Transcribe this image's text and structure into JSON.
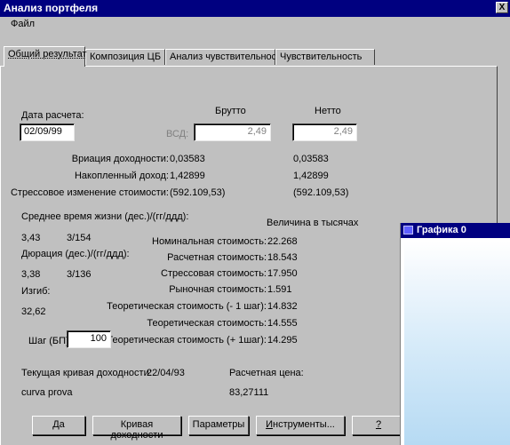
{
  "window": {
    "title": "Анализ портфеля",
    "close_label": "X"
  },
  "menu": {
    "file": "Файл"
  },
  "tabs": [
    {
      "label": "Общий результат"
    },
    {
      "label": "Композиция ЦБ"
    },
    {
      "label": "Анализ чувствительности"
    },
    {
      "label": "Чувствительность"
    }
  ],
  "calc": {
    "date_label": "Дата расчета:",
    "date_value": "02/09/99",
    "vsd_label": "ВСД:",
    "brutto_header": "Брутто",
    "netto_header": "Нетто",
    "brutto_value": "2,49",
    "netto_value": "2,49"
  },
  "metrics": [
    {
      "label": "Вриация доходности:",
      "brutto": "0,03583",
      "netto": "0,03583"
    },
    {
      "label": "Накопленный доход:",
      "brutto": "1,42899",
      "netto": "1,42899"
    },
    {
      "label": "Стрессовое изменение стоимости:",
      "brutto": "(592.109,53)",
      "netto": "(592.109,53)"
    }
  ],
  "life": {
    "label": "Среднее время жизни (дес.)/(гг/ддд):",
    "v1": "3,43",
    "v2": "3/154",
    "duration_label": "Дюрация (дес.)/(гг/ддд):",
    "d1": "3,38",
    "d2": "3/136",
    "convexity_label": "Изгиб:",
    "convexity_value": "32,62"
  },
  "values": {
    "header": "Величина в тысячах",
    "items": [
      {
        "label": "Номинальная стоимость:",
        "value": "22.268"
      },
      {
        "label": "Расчетная стоимость:",
        "value": "18.543"
      },
      {
        "label": "Стрессовая стоимость:",
        "value": "17.950"
      },
      {
        "label": "Рыночная стоимость:",
        "value": "1.591"
      },
      {
        "label": "Теоретическая стоимость (- 1 шаг):",
        "value": "14.832"
      },
      {
        "label": "Теоретическая стоимость:",
        "value": "14.555"
      },
      {
        "label": "Теоретическая стоимость (+ 1шаг):",
        "value": "14.295"
      }
    ]
  },
  "step": {
    "label": "Шаг (БП):",
    "value": "100"
  },
  "curve": {
    "label": "Текущая кривая доходности:",
    "date": "22/04/93",
    "name": "curva prova",
    "price_label": "Расчетная цена:",
    "price_value": "83,27111"
  },
  "buttons": {
    "yes_prefix": "",
    "yes_u": "Д",
    "yes_suffix": "а",
    "curve": "Кривая доходности",
    "params": "Параметры",
    "tools_u": "И",
    "tools_suffix": "нструменты...",
    "help_u": "?"
  },
  "child_window": {
    "title": "Графика 0"
  }
}
